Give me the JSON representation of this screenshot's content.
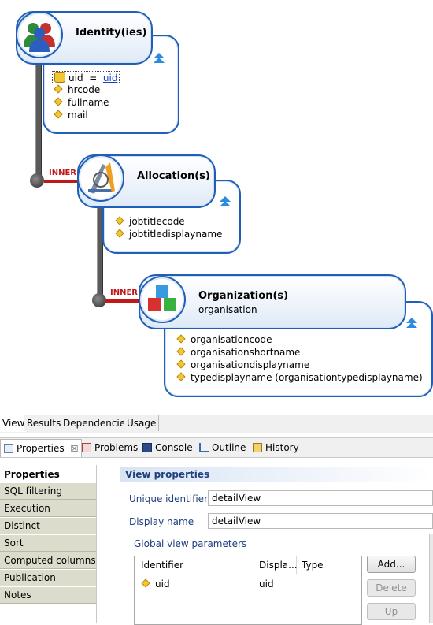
{
  "diagram": {
    "nodes": [
      {
        "title": "Identity(ies)",
        "icon": "users-icon",
        "key_field": {
          "name": "uid",
          "op": "=",
          "link": "uid"
        },
        "fields": [
          "hrcode",
          "fullname",
          "mail"
        ]
      },
      {
        "title": "Allocation(s)",
        "icon": "drafting-tools-icon",
        "join": "INNER",
        "fields": [
          "jobtitlecode",
          "jobtitledisplayname"
        ]
      },
      {
        "title": "Organization(s)",
        "subtitle": "organisation",
        "icon": "cubes-icon",
        "join": "INNER",
        "fields": [
          "organisationcode",
          "organisationshortname",
          "organisationdisplayname",
          "typedisplayname (organisationtypedisplayname)"
        ]
      }
    ]
  },
  "editor_tabs": [
    "View",
    "Results",
    "Dependencies",
    "Usage"
  ],
  "panel_tabs": [
    {
      "label": "Properties",
      "close": "☒",
      "icon": "properties-icon"
    },
    {
      "label": "Problems",
      "icon": "problems-icon"
    },
    {
      "label": "Console",
      "icon": "console-icon"
    },
    {
      "label": "Outline",
      "icon": "outline-icon"
    },
    {
      "label": "History",
      "icon": "history-icon"
    }
  ],
  "nav": [
    "Properties",
    "SQL filtering",
    "Execution",
    "Distinct",
    "Sort",
    "Computed columns",
    "Publication",
    "Notes"
  ],
  "view_properties": {
    "title": "View properties",
    "unique_id_label": "Unique identifier",
    "unique_id_value": "detailView",
    "display_name_label": "Display name",
    "display_name_value": "detailView",
    "params_label": "Global view parameters"
  },
  "params_table": {
    "headers": [
      "Identifier",
      "Displa...",
      "Type"
    ],
    "rows": [
      {
        "identifier": "uid",
        "display": "uid",
        "type": ""
      }
    ]
  },
  "buttons": {
    "add": "Add...",
    "delete": "Delete",
    "up": "Up"
  }
}
